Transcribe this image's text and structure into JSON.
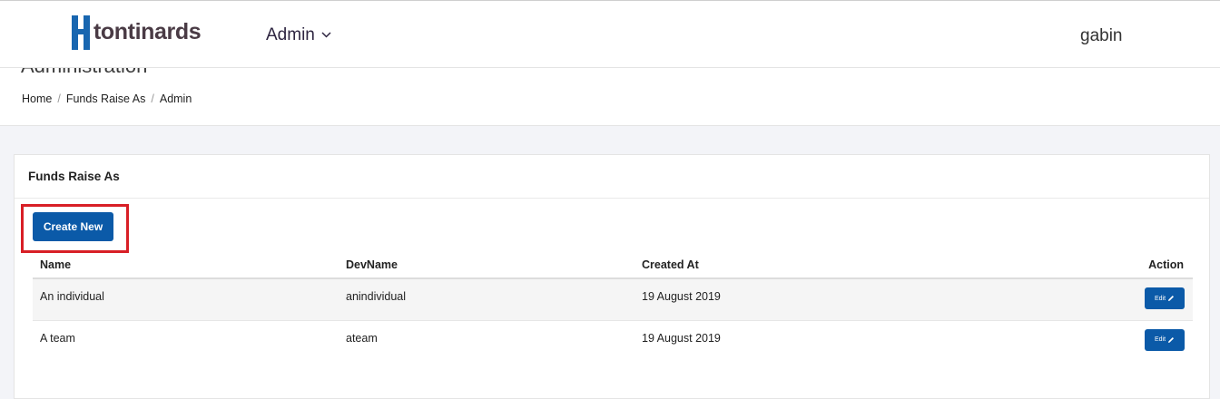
{
  "app": {
    "logo_text": "tontinards",
    "brand_color": "#1866b0",
    "accent_color": "#0b5aa8"
  },
  "navbar": {
    "menu_label": "Admin",
    "menu_icon": "chevron-down-icon",
    "username": "gabin"
  },
  "page_header": {
    "title": "Administration",
    "breadcrumb": [
      "Home",
      "Funds Raise As",
      "Admin"
    ]
  },
  "card": {
    "title": "Funds Raise As",
    "create_label": "Create New",
    "columns": [
      "Name",
      "DevName",
      "Created At",
      "Action"
    ],
    "rows": [
      {
        "name": "An individual",
        "devname": "anindividual",
        "created_at": "19 August 2019",
        "action_label": "Edit",
        "action_icon": "pencil-icon"
      },
      {
        "name": "A team",
        "devname": "ateam",
        "created_at": "19 August 2019",
        "action_label": "Edit",
        "action_icon": "pencil-icon"
      }
    ]
  }
}
